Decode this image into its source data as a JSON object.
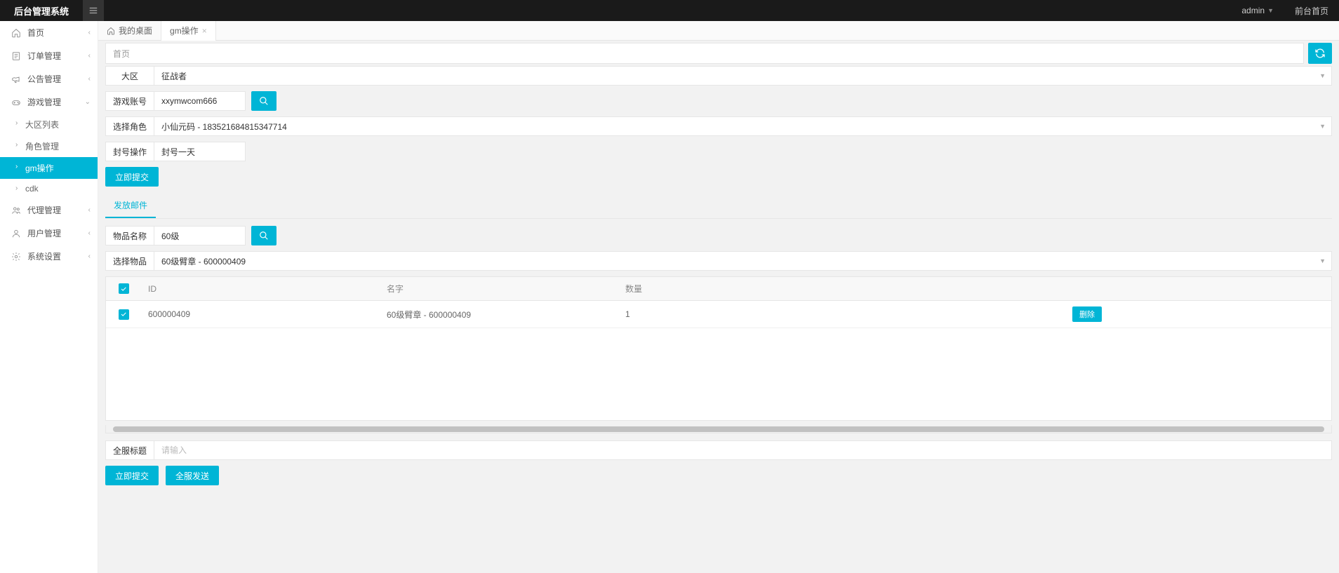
{
  "topbar": {
    "brand": "后台管理系统",
    "user": "admin",
    "front_link": "前台首页"
  },
  "sidebar": {
    "items": [
      {
        "label": "首页",
        "icon": "home",
        "expandable": true
      },
      {
        "label": "订单管理",
        "icon": "order",
        "expandable": true
      },
      {
        "label": "公告管理",
        "icon": "announce",
        "expandable": true
      },
      {
        "label": "游戏管理",
        "icon": "game",
        "expandable": true,
        "expanded": true,
        "children": [
          {
            "label": "大区列表"
          },
          {
            "label": "角色管理"
          },
          {
            "label": "gm操作",
            "active": true
          },
          {
            "label": "cdk"
          }
        ]
      },
      {
        "label": "代理管理",
        "icon": "agent",
        "expandable": true
      },
      {
        "label": "用户管理",
        "icon": "user",
        "expandable": true
      },
      {
        "label": "系统设置",
        "icon": "settings",
        "expandable": true
      }
    ]
  },
  "tabs": [
    {
      "label": "我的桌面",
      "icon": "home",
      "closable": false
    },
    {
      "label": "gm操作",
      "closable": true,
      "active": true
    }
  ],
  "breadcrumb": "首页",
  "form": {
    "region_label": "大区",
    "region_value": "征战者",
    "account_label": "游戏账号",
    "account_value": "xxymwcom666",
    "role_label": "选择角色",
    "role_value": "小仙元码 - 183521684815347714",
    "ban_label": "封号操作",
    "ban_value": "封号一天",
    "submit1": "立即提交",
    "mail_tab": "发放邮件",
    "item_name_label": "物品名称",
    "item_name_value": "60级",
    "item_select_label": "选择物品",
    "item_select_value": "60级臂章 - 600000409",
    "global_title_label": "全服标题",
    "global_title_placeholder": "请输入",
    "submit2": "立即提交",
    "send_all": "全服发送"
  },
  "table": {
    "headers": {
      "id": "ID",
      "name": "名字",
      "qty": "数量",
      "action": ""
    },
    "rows": [
      {
        "id": "600000409",
        "name": "60级臂章 - 600000409",
        "qty": "1",
        "action": "删除"
      }
    ]
  }
}
